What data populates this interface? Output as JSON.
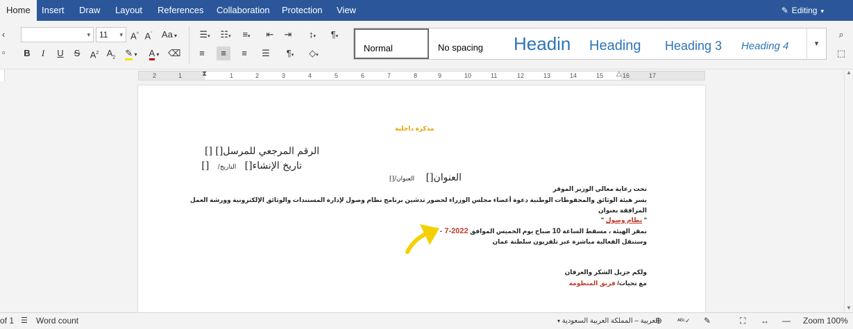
{
  "menu": {
    "tabs": [
      "Home",
      "Insert",
      "Draw",
      "Layout",
      "References",
      "Collaboration",
      "Protection",
      "View"
    ],
    "editing_label": "Editing"
  },
  "ribbon": {
    "font_name_value": "",
    "font_size_value": "11",
    "styles": [
      "Normal",
      "No spacing",
      "Headin",
      "Heading",
      "Heading 3",
      "Heading 4"
    ]
  },
  "ruler": {
    "labels": [
      "2",
      "1",
      "1",
      "2",
      "3",
      "4",
      "5",
      "6",
      "7",
      "8",
      "9",
      "10",
      "11",
      "12",
      "13",
      "14",
      "15",
      "16",
      "17"
    ]
  },
  "document": {
    "memo_title": "مذكرة داخلية",
    "ref_line": "الرقم المرجعي للمرسل[]     []",
    "date_line": "تاريخ الإنشاء[]",
    "date_small": "التاريخ/",
    "date_end": "[]",
    "address_line": "العنوان[]",
    "address_small": "العنوان/[]",
    "patronage": "تحت رعاية معالي الوزير الموقر",
    "body_1": "يسر هيئة الوثائق والمحفوظات الوطنية دعوة أعضاء مجلس الوزراء لحضور تدشين برنامج نظام وصول لإدارة المستندات والوثائق الإلكترونية وورشة العمل",
    "body_2": "المرافقة بعنوان",
    "quote_open": "\"",
    "quote_text": "نظام وصول",
    "quote_close": "\"",
    "venue_pre": "بمقر الهيئة ، مسقط الساعة",
    "venue_hour": "10",
    "venue_mid": "صباح يوم الخميس الموافق",
    "venue_date": "7 - 7-2022",
    "venue_end": "م",
    "broadcast": "وستنقل الفعالية مباشرة عبر تلفزيون سلطنة عمان",
    "thanks": "ولكم جزيل الشكر والعرفان",
    "regards_pre": "مع تحيات/",
    "regards_team": "فريق المنظومة"
  },
  "status": {
    "page_info": "of 1",
    "word_count": "Word count",
    "language": "العربية – المملكة العربية السعودية",
    "zoom": "Zoom 100%"
  },
  "colors": {
    "brand": "#2b579a",
    "memo_title": "#e5a100",
    "accent_red": "#c0392b",
    "heading_blue": "#2e74b5",
    "annotation_arrow": "#f5d000"
  }
}
